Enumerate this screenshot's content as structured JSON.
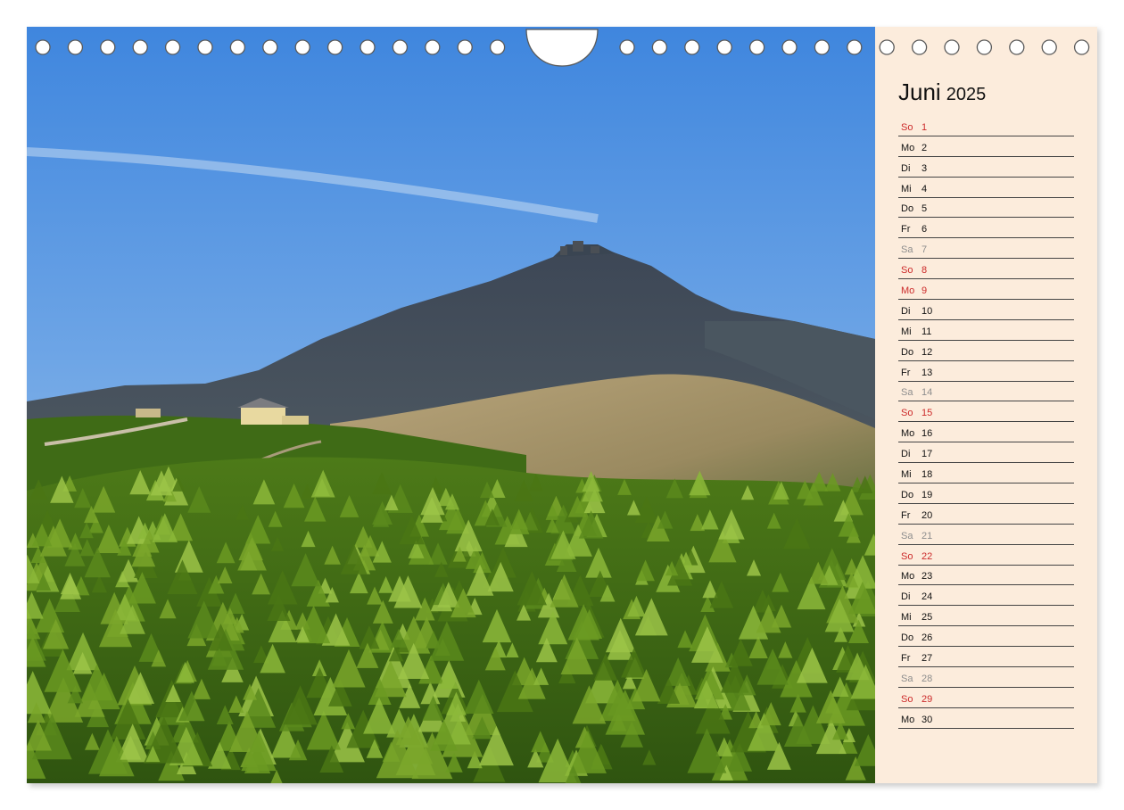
{
  "calendar": {
    "month": "Juni",
    "year": "2025",
    "days": [
      {
        "wd": "So",
        "d": "1",
        "type": "sun"
      },
      {
        "wd": "Mo",
        "d": "2",
        "type": "work"
      },
      {
        "wd": "Di",
        "d": "3",
        "type": "work"
      },
      {
        "wd": "Mi",
        "d": "4",
        "type": "work"
      },
      {
        "wd": "Do",
        "d": "5",
        "type": "work"
      },
      {
        "wd": "Fr",
        "d": "6",
        "type": "work"
      },
      {
        "wd": "Sa",
        "d": "7",
        "type": "sat"
      },
      {
        "wd": "So",
        "d": "8",
        "type": "sun"
      },
      {
        "wd": "Mo",
        "d": "9",
        "type": "hol"
      },
      {
        "wd": "Di",
        "d": "10",
        "type": "work"
      },
      {
        "wd": "Mi",
        "d": "11",
        "type": "work"
      },
      {
        "wd": "Do",
        "d": "12",
        "type": "work"
      },
      {
        "wd": "Fr",
        "d": "13",
        "type": "work"
      },
      {
        "wd": "Sa",
        "d": "14",
        "type": "sat"
      },
      {
        "wd": "So",
        "d": "15",
        "type": "sun"
      },
      {
        "wd": "Mo",
        "d": "16",
        "type": "work"
      },
      {
        "wd": "Di",
        "d": "17",
        "type": "work"
      },
      {
        "wd": "Mi",
        "d": "18",
        "type": "work"
      },
      {
        "wd": "Do",
        "d": "19",
        "type": "work"
      },
      {
        "wd": "Fr",
        "d": "20",
        "type": "work"
      },
      {
        "wd": "Sa",
        "d": "21",
        "type": "sat"
      },
      {
        "wd": "So",
        "d": "22",
        "type": "sun"
      },
      {
        "wd": "Mo",
        "d": "23",
        "type": "work"
      },
      {
        "wd": "Di",
        "d": "24",
        "type": "work"
      },
      {
        "wd": "Mi",
        "d": "25",
        "type": "work"
      },
      {
        "wd": "Do",
        "d": "26",
        "type": "work"
      },
      {
        "wd": "Fr",
        "d": "27",
        "type": "work"
      },
      {
        "wd": "Sa",
        "d": "28",
        "type": "sat"
      },
      {
        "wd": "So",
        "d": "29",
        "type": "sun"
      },
      {
        "wd": "Mo",
        "d": "30",
        "type": "work"
      }
    ]
  },
  "colors": {
    "panel_bg": "#fcecdc",
    "sunday_red": "#cc2a2a",
    "saturday_gray": "#8d8d8d",
    "sky": "#5a9ae0",
    "dwarf_pine": "#5c8a1e"
  },
  "photo": {
    "subject": "mountain-landscape-photo"
  },
  "binding": {
    "icon": "wire-binding-holes"
  }
}
